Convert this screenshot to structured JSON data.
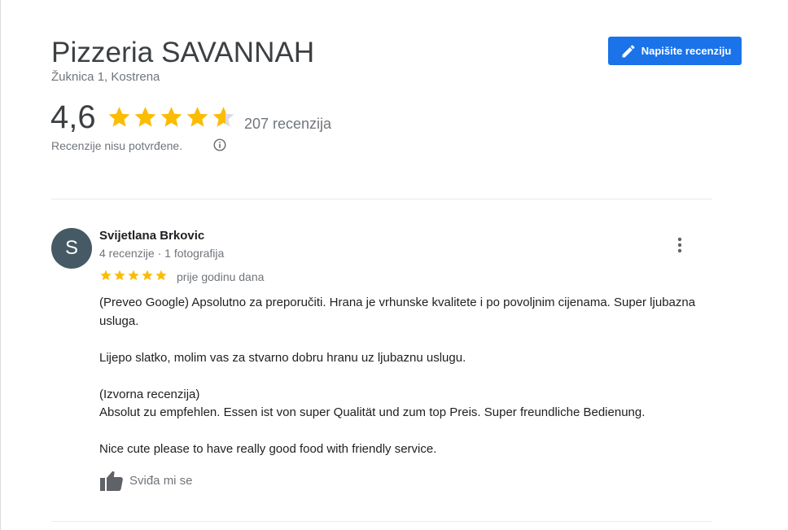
{
  "place": {
    "title": "Pizzeria SAVANNAH",
    "address": "Žuknica 1, Kostrena"
  },
  "actions": {
    "write_review_label": "Napišite recenziju",
    "write_review_icon": "pencil-icon"
  },
  "summary": {
    "rating": "4,6",
    "rating_value": 4.6,
    "stars_max": 5,
    "review_count_label": "207 recenzija",
    "unverified_note": "Recenzije nisu potvrđene.",
    "info_icon": "info-icon"
  },
  "colors": {
    "accent": "#1a73e8",
    "star": "#fbbc04",
    "star_empty": "#dadce0",
    "secondary_text": "#70757a",
    "avatar_bg": "#455a64"
  },
  "review": {
    "avatar_letter": "S",
    "author": "Svijetlana Brkovic",
    "meta": "4 recenzije · 1 fotografija",
    "stars": 5,
    "date": "prije godinu dana",
    "paragraphs": [
      "(Preveo Google) Apsolutno za preporučiti. Hrana je vrhunske kvalitete i po povoljnim cijenama. Super ljubazna usluga.",
      "Lijepo slatko, molim vas za stvarno dobru hranu uz ljubaznu uslugu.",
      "(Izvorna recenzija)",
      "Absolut zu empfehlen. Essen ist von super Qualität und zum top Preis. Super freundliche Bedienung.",
      "Nice cute please to have really good food with friendly service."
    ],
    "like_label": "Sviđa mi se",
    "like_icon": "thumb-up-icon",
    "menu_icon": "more-vert-icon"
  }
}
